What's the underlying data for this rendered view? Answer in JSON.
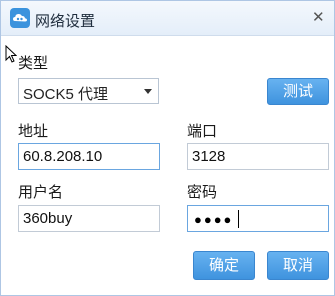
{
  "window": {
    "title": "网络设置",
    "close_icon": "close-icon"
  },
  "proxy": {
    "type_label": "类型",
    "type_value": "SOCK5 代理",
    "test_button": "测试"
  },
  "address": {
    "label": "地址",
    "value": "60.8.208.10"
  },
  "port": {
    "label": "端口",
    "value": "3128"
  },
  "username": {
    "label": "用户名",
    "value": "360buy"
  },
  "password": {
    "label": "密码",
    "masked": "●●●●"
  },
  "actions": {
    "ok": "确定",
    "cancel": "取消"
  },
  "colors": {
    "accent": "#3f93de",
    "border": "#aec6e4"
  }
}
